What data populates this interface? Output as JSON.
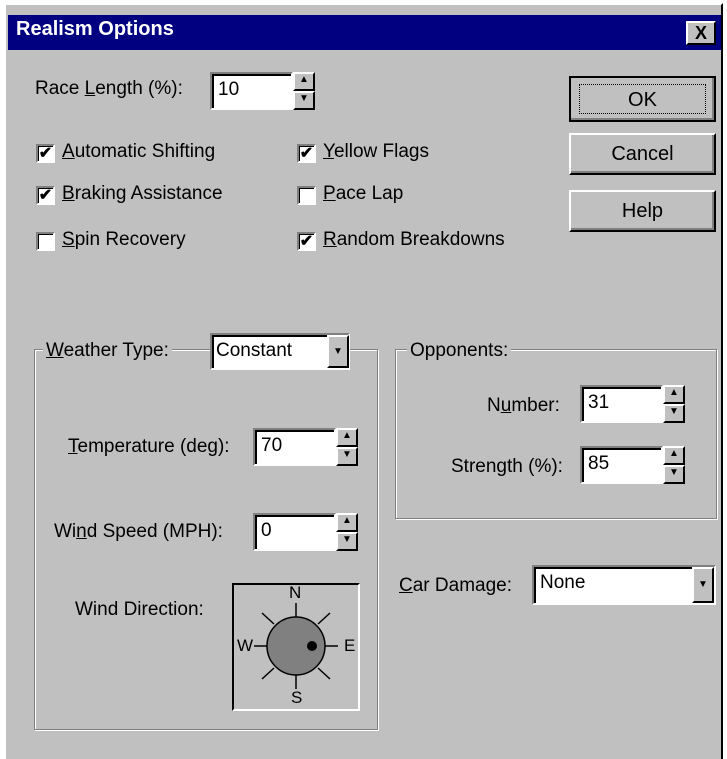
{
  "window": {
    "title": "Realism Options",
    "close_glyph": "X"
  },
  "race": {
    "label_pre": "Race ",
    "label_u": "L",
    "label_post": "ength (%):",
    "value": "10"
  },
  "checkboxes": [
    {
      "u": "A",
      "rest": "utomatic Shifting",
      "checked": true
    },
    {
      "u": "B",
      "rest": "raking Assistance",
      "checked": true
    },
    {
      "u": "S",
      "rest": "pin Recovery",
      "checked": false
    },
    {
      "u": "Y",
      "rest": "ellow Flags",
      "checked": true
    },
    {
      "u": "P",
      "rest": "ace Lap",
      "checked": false
    },
    {
      "u": "R",
      "rest": "andom Breakdowns",
      "checked": true
    }
  ],
  "buttons": {
    "ok": "OK",
    "cancel": "Cancel",
    "help": "Help"
  },
  "weather": {
    "label_u": "W",
    "label_rest": "eather Type:",
    "value": "Constant",
    "temperature": {
      "label_u": "T",
      "label_rest": "emperature (deg):",
      "value": "70"
    },
    "wind_speed": {
      "label_pre": "Wi",
      "label_u": "n",
      "label_post": "d Speed (MPH):",
      "value": "0"
    },
    "wind_direction": {
      "label": "Wind Direction:",
      "n": "N",
      "e": "E",
      "s": "S",
      "w": "W"
    }
  },
  "opponents": {
    "legend": "Opponents:",
    "number": {
      "label_pre": "N",
      "label_u": "u",
      "label_post": "mber:",
      "value": "31"
    },
    "strength": {
      "label_pre": "Stren",
      "label_u": "g",
      "label_post": "th (%):",
      "value": "85"
    }
  },
  "car_damage": {
    "label_u": "C",
    "label_rest": "ar Damage:",
    "value": "None"
  },
  "icons": {
    "spin_up": "up-arrow-icon",
    "spin_down": "down-arrow-icon",
    "dropdown": "chevron-down-icon",
    "check": "checkmark-icon"
  },
  "colors": {
    "face": "#c0c0c0",
    "titlebar": "#000080",
    "compass_disc": "#808080"
  }
}
